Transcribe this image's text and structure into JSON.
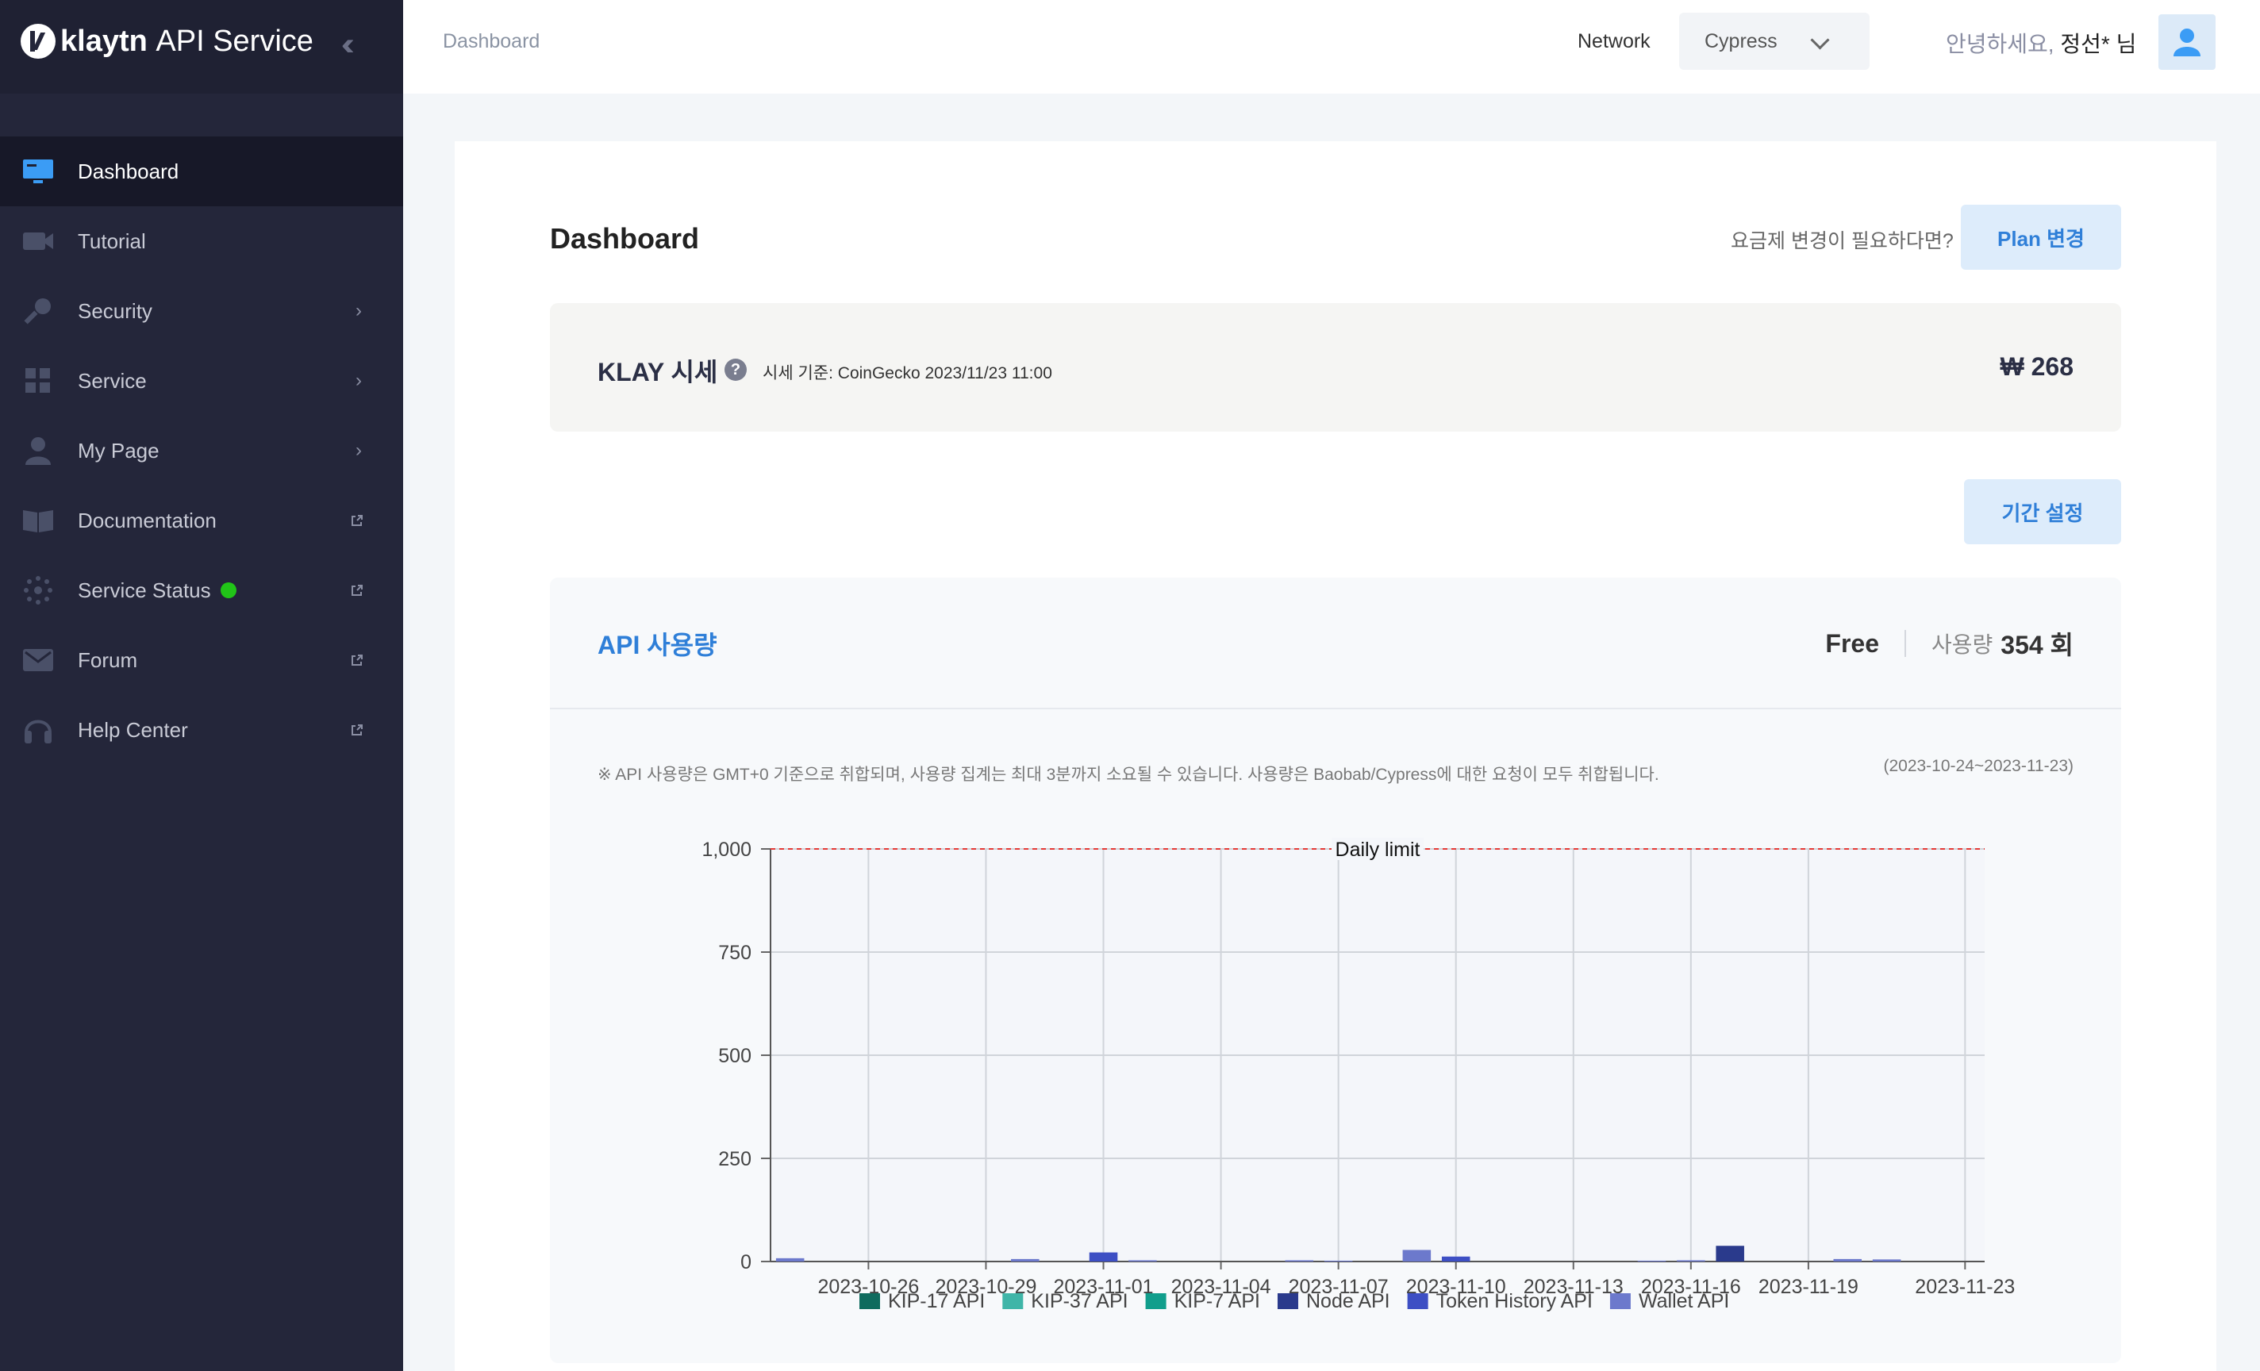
{
  "app": {
    "logo_text": "klaytn",
    "logo_suffix": "API Service"
  },
  "sidebar": {
    "items": [
      {
        "label": "Dashboard",
        "icon": "monitor-icon",
        "active": true
      },
      {
        "label": "Tutorial",
        "icon": "video-icon"
      },
      {
        "label": "Security",
        "icon": "key-icon",
        "has_submenu": true
      },
      {
        "label": "Service",
        "icon": "grid-icon",
        "has_submenu": true
      },
      {
        "label": "My Page",
        "icon": "user-icon",
        "has_submenu": true
      },
      {
        "label": "Documentation",
        "icon": "book-icon",
        "external": true
      },
      {
        "label": "Service Status",
        "icon": "status-icon",
        "external": true,
        "status_color": "#21c418"
      },
      {
        "label": "Forum",
        "icon": "forum-icon",
        "external": true
      },
      {
        "label": "Help Center",
        "icon": "headset-icon",
        "external": true
      }
    ]
  },
  "header": {
    "breadcrumb": "Dashboard",
    "network_label": "Network",
    "network_value": "Cypress",
    "greeting": "안녕하세요,",
    "user_name": "정선* 님"
  },
  "main": {
    "title": "Dashboard",
    "plan_question": "요금제 변경이 필요하다면?",
    "plan_button": "Plan 변경",
    "price": {
      "title": "KLAY 시세",
      "source": "시세 기준: CoinGecko 2023/11/23 11:00",
      "value": "₩ 268"
    },
    "period_button": "기간 설정",
    "usage": {
      "title": "API 사용량",
      "plan": "Free",
      "count_label": "사용량",
      "count_value": "354 회",
      "note": "※ API 사용량은 GMT+0 기준으로 취합되며, 사용량 집계는 최대 3분까지 소요될 수 있습니다. 사용량은 Baobab/Cypress에 대한 요청이 모두 취합됩니다.",
      "range": "(2023-10-24~2023-11-23)"
    }
  },
  "colors": {
    "accent": "#2f7fd8",
    "sidebar_bg": "#24263a",
    "limit_line": "#e53935"
  },
  "chart_data": {
    "type": "bar",
    "stacked": true,
    "ylim": [
      0,
      1000
    ],
    "yticks": [
      0,
      250,
      500,
      750,
      1000
    ],
    "ytick_labels": [
      "0",
      "250",
      "500",
      "750",
      "1,000"
    ],
    "xtick_labels": [
      "2023-10-26",
      "2023-10-29",
      "2023-11-01",
      "2023-11-04",
      "2023-11-07",
      "2023-11-10",
      "2023-11-13",
      "2023-11-16",
      "2023-11-19",
      "2023-11-23"
    ],
    "xtick_days": [
      2,
      5,
      8,
      11,
      14,
      17,
      20,
      23,
      26,
      30
    ],
    "x_days": 31,
    "annotation": "Daily limit",
    "limit_value": 1000,
    "legend": [
      {
        "name": "KIP-17 API",
        "color": "#0f6b5e"
      },
      {
        "name": "KIP-37 API",
        "color": "#3fb5a8"
      },
      {
        "name": "KIP-7 API",
        "color": "#109e8c"
      },
      {
        "name": "Node API",
        "color": "#2a3a8c"
      },
      {
        "name": "Token History API",
        "color": "#3d4fc4"
      },
      {
        "name": "Wallet API",
        "color": "#6c79cc"
      }
    ],
    "bars": [
      {
        "day": 0,
        "series": "Wallet API",
        "value": 8
      },
      {
        "day": 6,
        "series": "Wallet API",
        "value": 6
      },
      {
        "day": 8,
        "series": "Token History API",
        "value": 22
      },
      {
        "day": 9,
        "series": "Wallet API",
        "value": 3
      },
      {
        "day": 13,
        "series": "Wallet API",
        "value": 3
      },
      {
        "day": 14,
        "series": "Wallet API",
        "value": 2
      },
      {
        "day": 16,
        "series": "Wallet API",
        "value": 28
      },
      {
        "day": 17,
        "series": "Token History API",
        "value": 12
      },
      {
        "day": 22,
        "series": "Wallet API",
        "value": 2
      },
      {
        "day": 23,
        "series": "Wallet API",
        "value": 3
      },
      {
        "day": 24,
        "series": "Node API",
        "value": 38
      },
      {
        "day": 27,
        "series": "Wallet API",
        "value": 6
      },
      {
        "day": 28,
        "series": "Wallet API",
        "value": 5
      }
    ]
  }
}
